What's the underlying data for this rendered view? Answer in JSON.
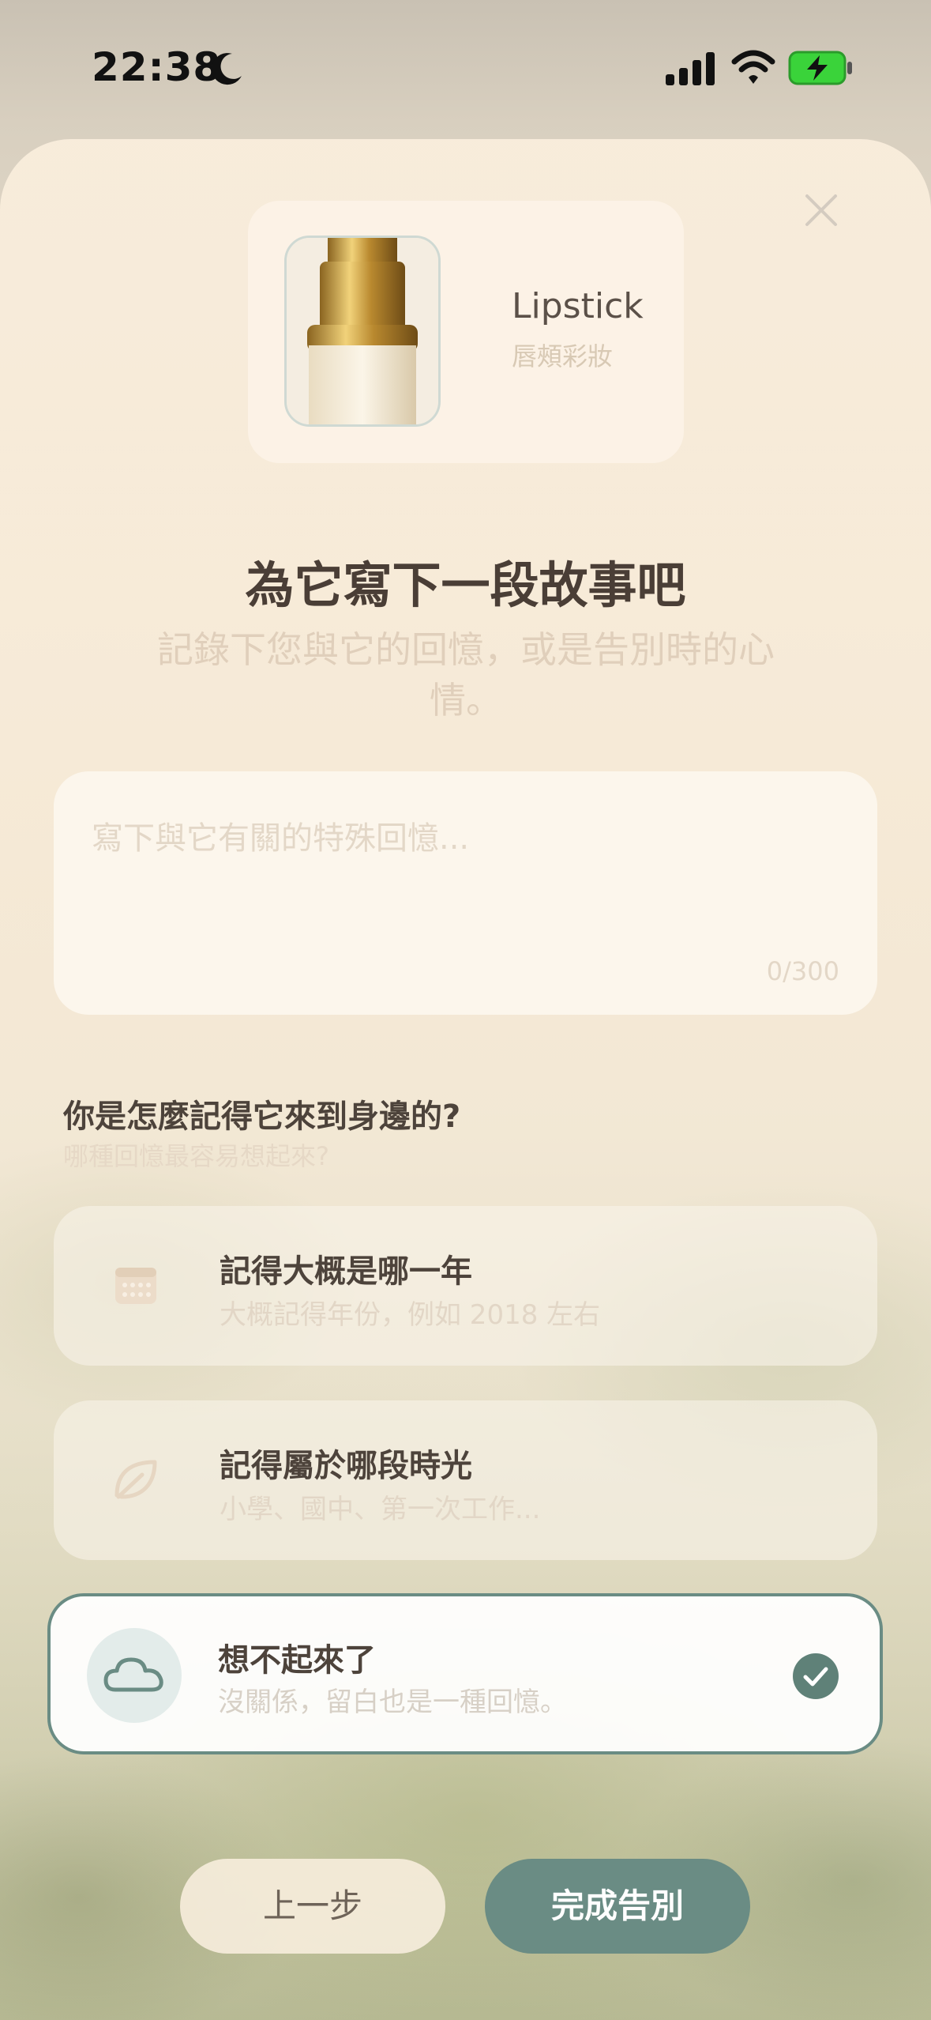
{
  "status_bar": {
    "time": "22:38"
  },
  "product": {
    "name": "Lipstick",
    "category": "唇頰彩妝"
  },
  "page": {
    "title": "為它寫下一段故事吧",
    "subtitle": "記錄下您與它的回憶，或是告別時的心情。"
  },
  "story_input": {
    "placeholder": "寫下與它有關的特殊回憶...",
    "counter": "0/300"
  },
  "question": {
    "title": "你是怎麼記得它來到身邊的?",
    "subtitle": "哪種回憶最容易想起來?"
  },
  "options": [
    {
      "title": "記得大概是哪一年",
      "subtitle": "大概記得年份，例如 2018 左右",
      "icon": "calendar-icon",
      "selected": false
    },
    {
      "title": "記得屬於哪段時光",
      "subtitle": "小學、國中、第一次工作...",
      "icon": "leaf-icon",
      "selected": false
    },
    {
      "title": "想不起來了",
      "subtitle": "沒關係，留白也是一種回憶。",
      "icon": "cloud-icon",
      "selected": true
    }
  ],
  "buttons": {
    "back": "上一步",
    "finish": "完成告別"
  },
  "colors": {
    "accent": "#6a8c84",
    "title": "#4a3e36",
    "muted": "#e0cfbb"
  }
}
